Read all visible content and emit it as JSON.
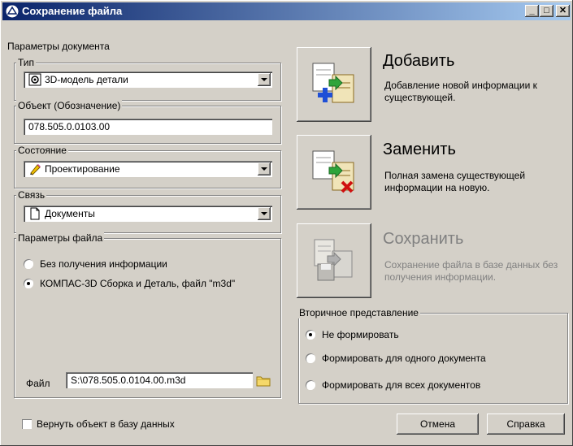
{
  "window": {
    "title": "Сохранение файла",
    "minimize": "_",
    "maximize": "□",
    "close": "✕"
  },
  "left": {
    "doc_params_label": "Параметры документа",
    "type": {
      "legend": "Тип",
      "value": "3D-модель детали"
    },
    "object": {
      "legend": "Объект (Обозначение)",
      "value": "078.505.0.0103.00"
    },
    "state": {
      "legend": "Состояние",
      "value": "Проектирование"
    },
    "link": {
      "legend": "Связь",
      "value": "Документы"
    },
    "file_params": {
      "legend": "Параметры файла",
      "options": [
        {
          "label": "Без получения информации",
          "selected": false
        },
        {
          "label": "КОМПАС-3D Сборка и Деталь, файл \"m3d\"",
          "selected": true
        }
      ],
      "file_label": "Файл",
      "file_value": "S:\\078.505.0.0104.00.m3d"
    },
    "return_checkbox": "Вернуть объект в базу данных"
  },
  "actions": [
    {
      "title": "Добавить",
      "desc": "Добавление новой информации к существующей.",
      "enabled": true
    },
    {
      "title": "Заменить",
      "desc": "Полная замена существующей информации на новую.",
      "enabled": true
    },
    {
      "title": "Сохранить",
      "desc": "Сохранение файла в базе данных без получения информации.",
      "enabled": false
    }
  ],
  "secondary": {
    "legend": "Вторичное представление",
    "options": [
      {
        "label": "Не формировать",
        "selected": true
      },
      {
        "label": "Формировать для одного документа",
        "selected": false
      },
      {
        "label": "Формировать для всех документов",
        "selected": false
      }
    ]
  },
  "buttons": {
    "cancel": "Отмена",
    "help": "Справка"
  },
  "icons": {
    "title": "kompas-logo-icon",
    "type": "part-model-icon",
    "state": "pencil-icon",
    "link": "document-icon",
    "browse": "folder-icon"
  }
}
